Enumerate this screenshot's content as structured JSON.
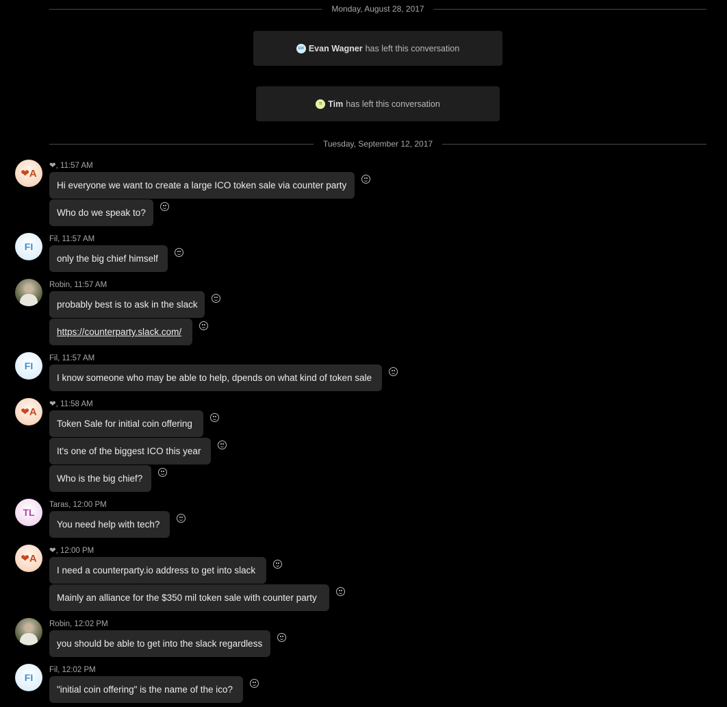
{
  "dates": [
    "Monday, August 28, 2017",
    "Tuesday, September 12, 2017"
  ],
  "system": [
    {
      "avatar_initials": "EW",
      "name": "Evan Wagner",
      "text": "has left this conversation",
      "avatar_color": "#d7ecf7"
    },
    {
      "avatar_initials": "TI",
      "name": "Tim",
      "text": "has left this conversation",
      "avatar_color": "#e6f2a8"
    }
  ],
  "avatars": {
    "heart": "❤A",
    "fil": "FI",
    "taras": "TL"
  },
  "groups": [
    {
      "meta": "❤, 11:57 AM",
      "messages": [
        "Hi everyone we want to create a large ICO token sale via counter party",
        "Who do we speak to?"
      ]
    },
    {
      "meta": "Fil, 11:57 AM",
      "messages": [
        "only the big chief himself"
      ]
    },
    {
      "meta": "Robin, 11:57 AM",
      "messages": [
        "probably best is to ask in the slack",
        "https://counterparty.slack.com/"
      ]
    },
    {
      "meta": "Fil, 11:57 AM",
      "messages": [
        "I know someone who may be able to help, dpends on what kind of token sale"
      ]
    },
    {
      "meta": "❤, 11:58 AM",
      "messages": [
        "Token Sale for initial coin offering",
        "It's one of the biggest ICO this year",
        "Who is the big chief?"
      ]
    },
    {
      "meta": "Taras, 12:00 PM",
      "messages": [
        "You need help with tech?"
      ]
    },
    {
      "meta": "❤, 12:00 PM",
      "messages": [
        "I need a counterparty.io address to get into slack",
        "Mainly an alliance for the $350 mil token sale with counter party"
      ]
    },
    {
      "meta": "Robin, 12:02 PM",
      "messages": [
        "you should be able to get into the slack regardless"
      ]
    },
    {
      "meta": "Fil, 12:02 PM",
      "messages": [
        "\"initial coin offering\" is the name of the ico?"
      ]
    }
  ]
}
